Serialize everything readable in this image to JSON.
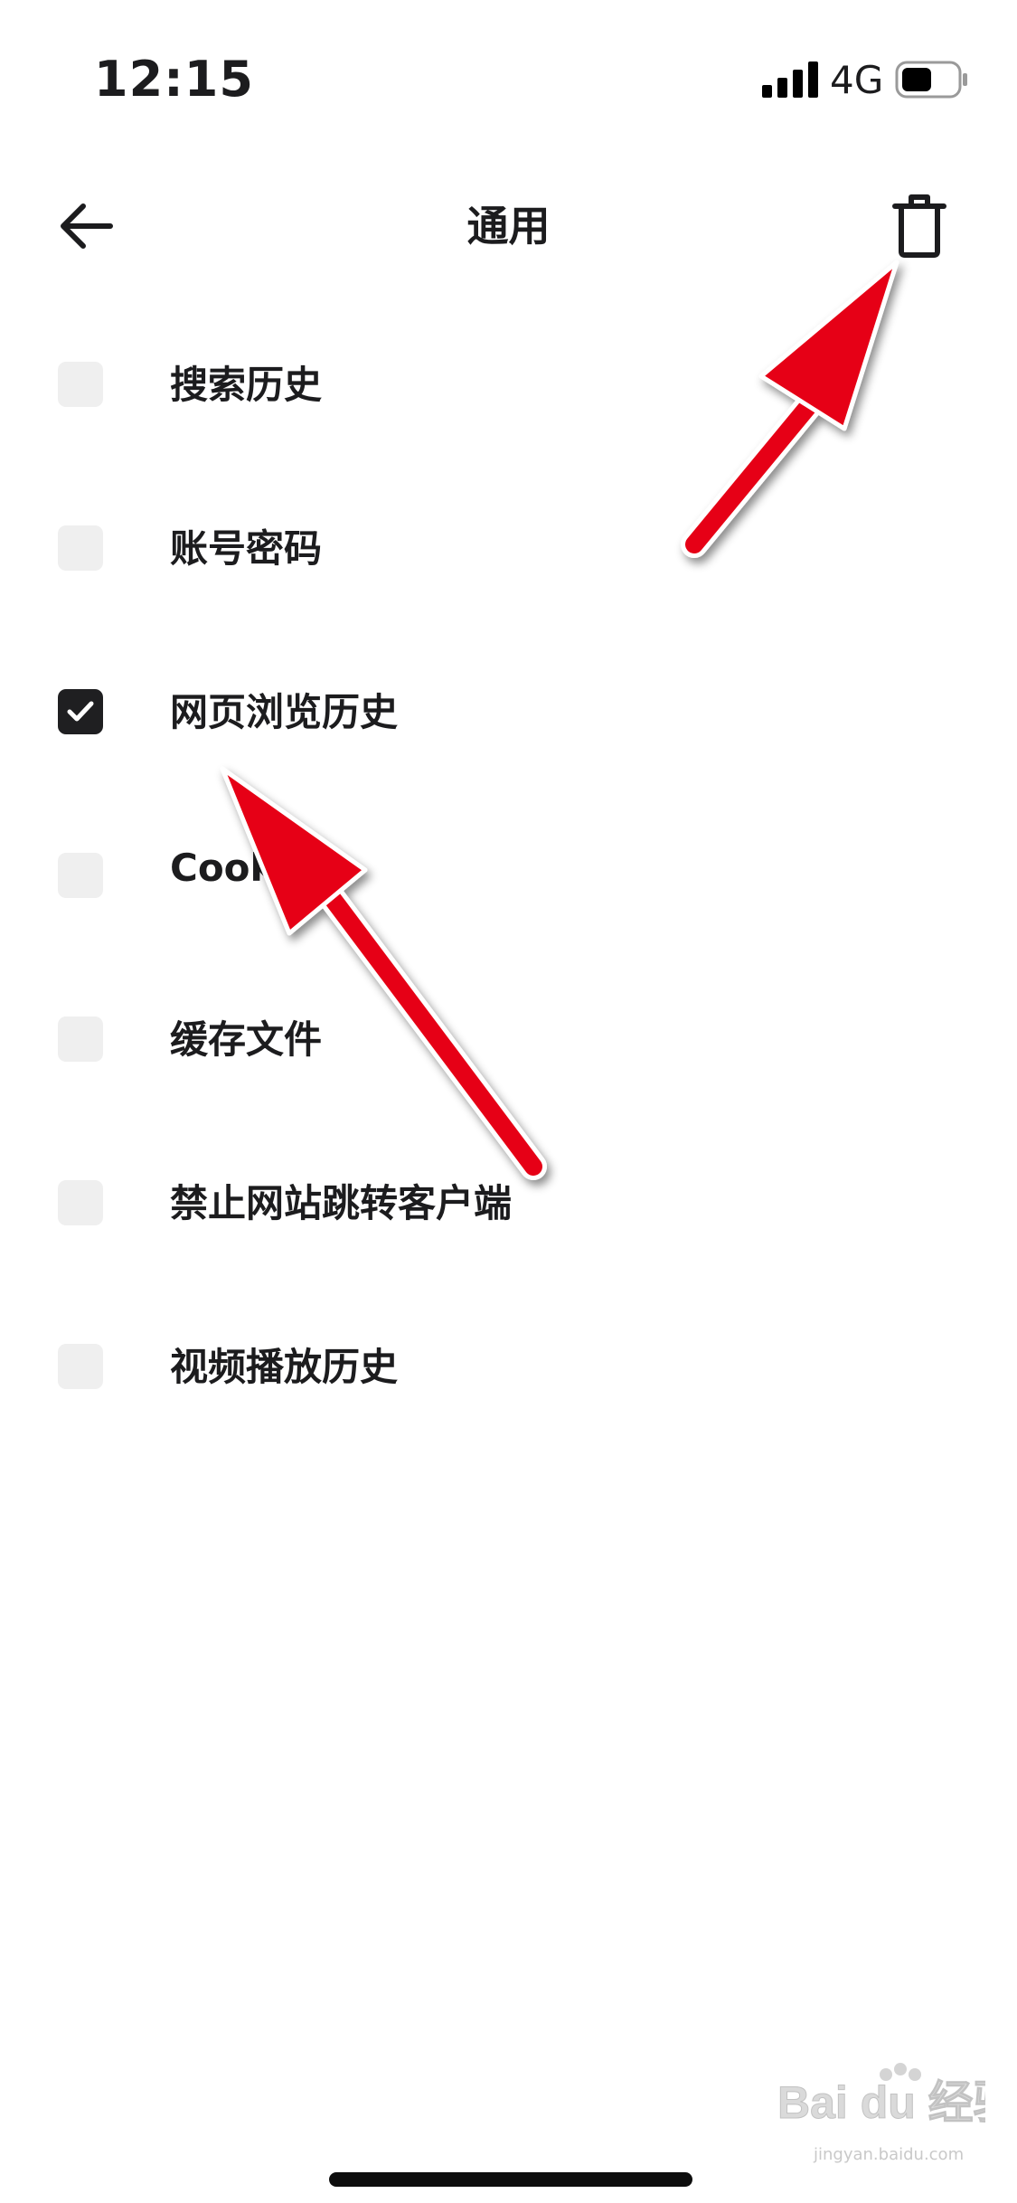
{
  "status_bar": {
    "time": "12:15",
    "network": "4G",
    "icons": [
      "signal-icon",
      "battery-icon"
    ]
  },
  "nav": {
    "title": "通用",
    "back_icon": "arrow-left-icon",
    "trash_icon": "trash-icon"
  },
  "options": [
    {
      "label": "搜索历史",
      "checked": false
    },
    {
      "label": "账号密码",
      "checked": false
    },
    {
      "label": "网页浏览历史",
      "checked": true
    },
    {
      "label": "Cookies",
      "checked": false
    },
    {
      "label": "缓存文件",
      "checked": false
    },
    {
      "label": "禁止网站跳转客户端",
      "checked": false
    },
    {
      "label": "视频播放历史",
      "checked": false
    }
  ],
  "watermark": {
    "brand": "Bai du 经验",
    "url": "jingyan.baidu.com"
  },
  "colors": {
    "accent_annotation": "#e60012",
    "checkbox_checked": "#1f1f21",
    "checkbox_unchecked": "#efefef"
  }
}
